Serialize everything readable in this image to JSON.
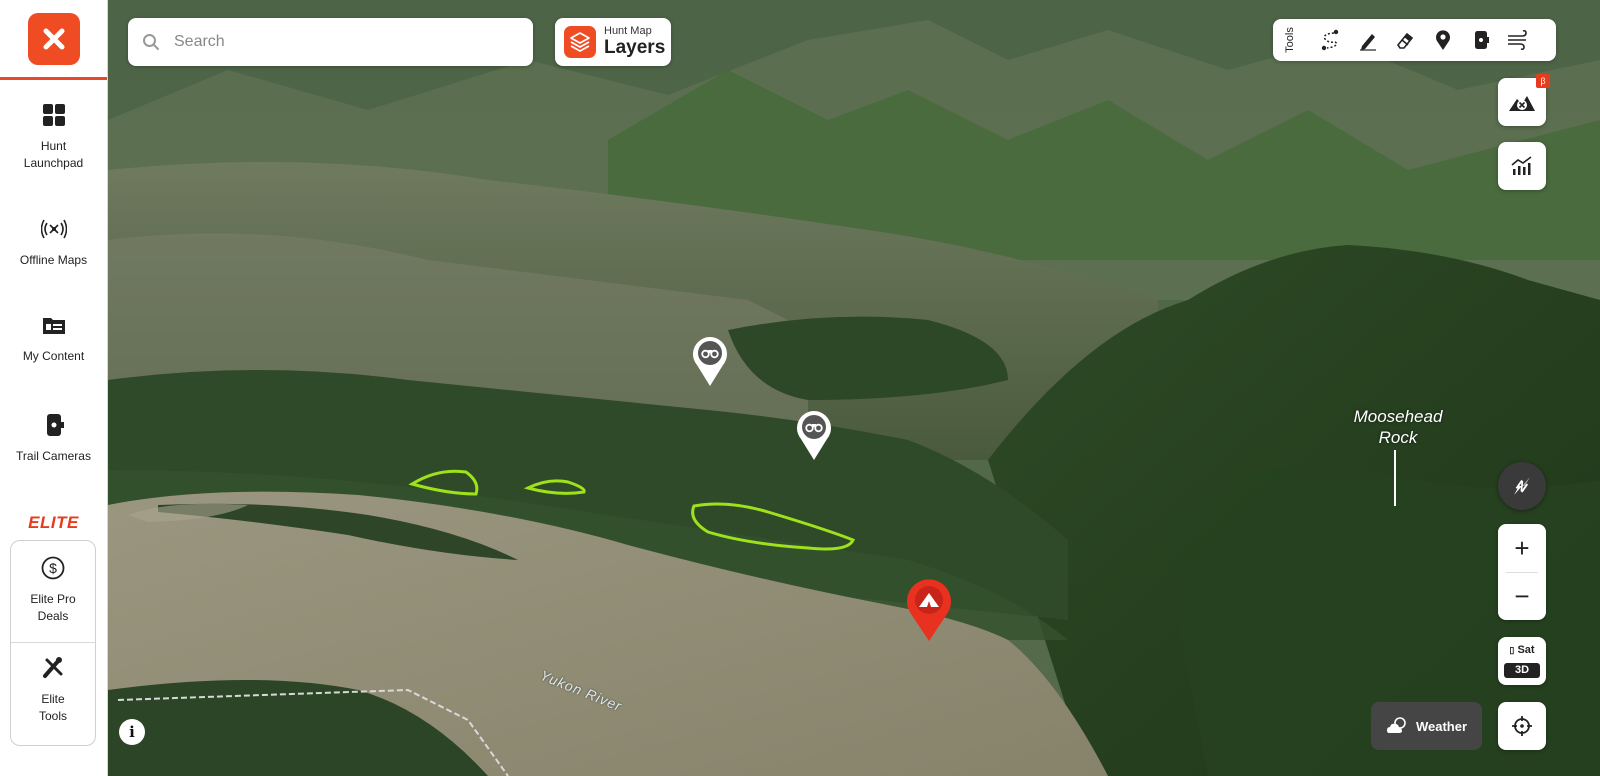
{
  "sidebar": {
    "items": [
      {
        "label_line1": "Hunt",
        "label_line2": "Launchpad",
        "icon": "grid-icon"
      },
      {
        "label_line1": "Offline Maps",
        "label_line2": "",
        "icon": "signal-broadcast-icon"
      },
      {
        "label_line1": "My Content",
        "label_line2": "",
        "icon": "folder-icon"
      },
      {
        "label_line1": "Trail Cameras",
        "label_line2": "",
        "icon": "trail-camera-icon"
      }
    ],
    "elite_badge": "ELITE",
    "elite_items": [
      {
        "label_line1": "Elite Pro",
        "label_line2": "Deals",
        "icon": "dollar-circle-icon"
      },
      {
        "label_line1": "Elite",
        "label_line2": "Tools",
        "icon": "tools-icon"
      }
    ]
  },
  "search": {
    "placeholder": "Search",
    "value": ""
  },
  "layers": {
    "subtitle": "Hunt Map",
    "title": "Layers"
  },
  "tools": {
    "label": "Tools",
    "items": [
      "route-icon",
      "pencil-icon",
      "eraser-icon",
      "waypoint-pin-icon",
      "trail-camera-icon",
      "wind-icon"
    ]
  },
  "map_controls": {
    "beta_badge": "β",
    "sat_label": "Sat",
    "mode_label": "3D",
    "zoom_in": "+",
    "zoom_out": "−",
    "weather_label": "Weather"
  },
  "map_labels": {
    "place_line1": "Moosehead",
    "place_line2": "Rock",
    "river": "Yukon River"
  },
  "markers": [
    {
      "type": "observation",
      "icon": "binoculars-icon"
    },
    {
      "type": "observation",
      "icon": "binoculars-icon"
    },
    {
      "type": "camp",
      "icon": "tent-icon"
    }
  ],
  "colors": {
    "brand": "#f04c23",
    "highlight_outline": "#9ee21c",
    "river": "#8d8a73",
    "terrain": "#3f5a33"
  }
}
